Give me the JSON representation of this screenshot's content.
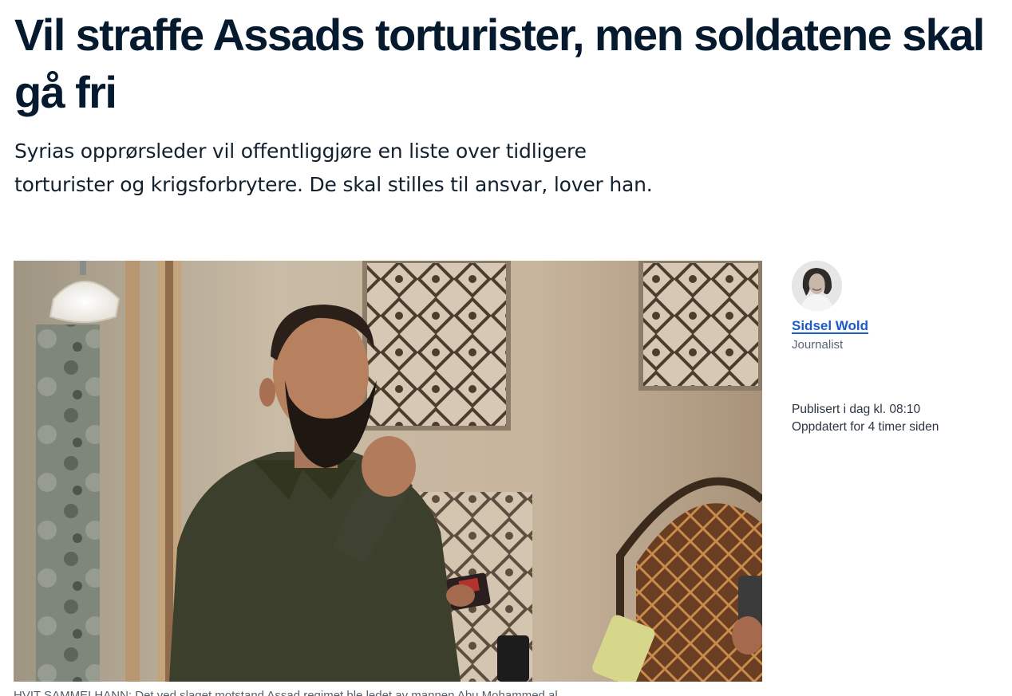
{
  "article": {
    "headline": "Vil straffe Assads torturister, men soldatene skal gå fri",
    "lead": "Syrias opprørsleder vil offentliggjøre en liste over tidligere torturister og krigsforbrytere. De skal stilles til ansvar, lover han.",
    "caption": "HVIT SAMMELHANN: Det ved slaget motstand Assad regimet ble ledet av mannen Abu Mohammed al"
  },
  "byline": {
    "author_name": "Sidsel Wold",
    "author_role": "Journalist"
  },
  "meta": {
    "published": "Publisert i dag kl. 08:10",
    "updated": "Oppdatert for 4 timer siden"
  },
  "colors": {
    "headline": "#061a2f",
    "link": "#1d5bc8",
    "meta": "#2d3742"
  },
  "icons": {
    "hero": "photo-speaker-mosque",
    "avatar": "author-portrait"
  }
}
